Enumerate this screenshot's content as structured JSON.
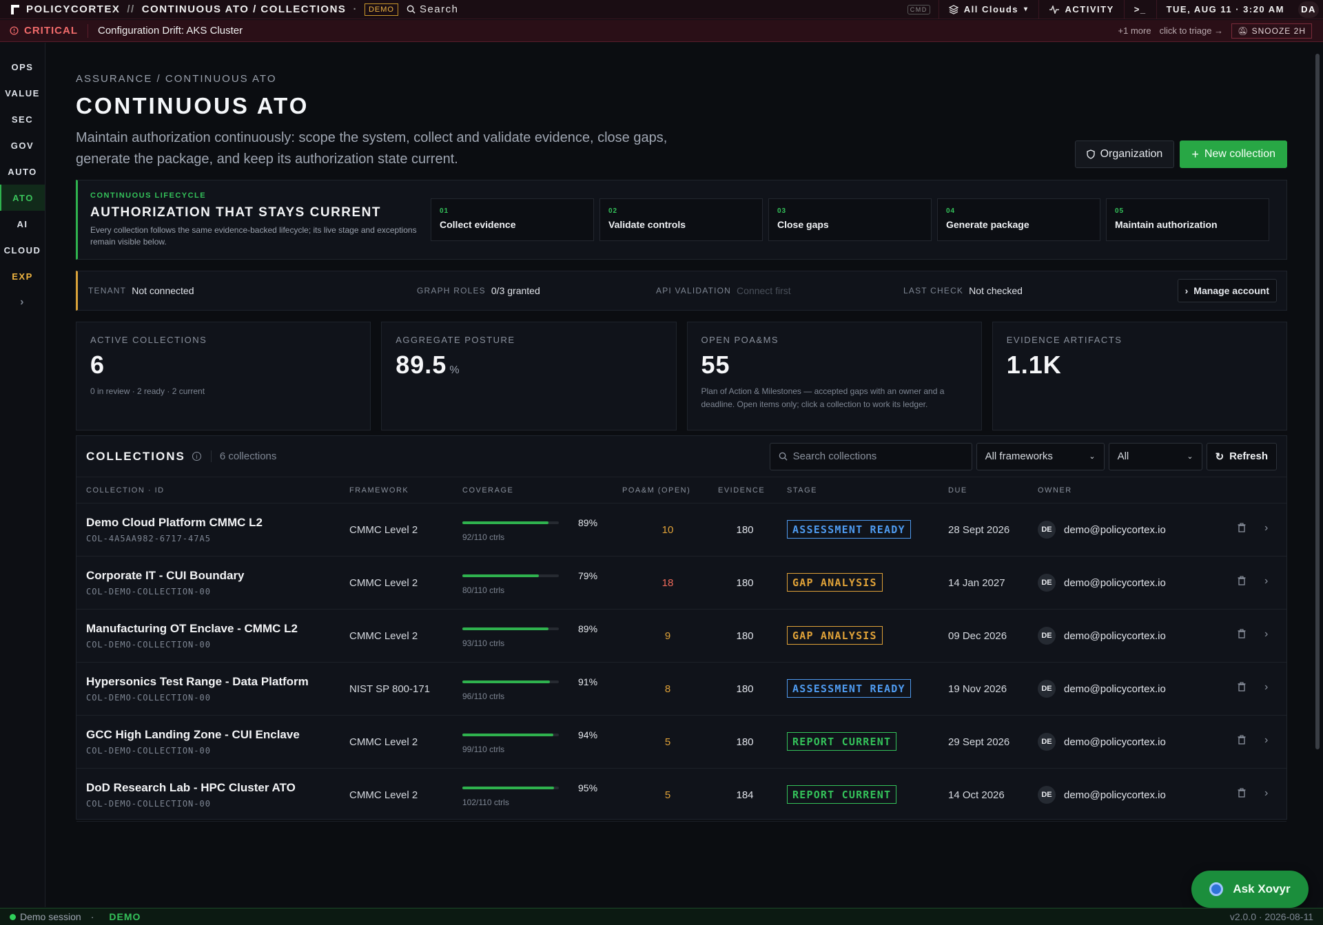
{
  "topbar": {
    "brand": "POLICYCORTEX",
    "sep": "//",
    "path": "CONTINUOUS ATO / COLLECTIONS",
    "dot": "·",
    "demo_badge": "DEMO",
    "search_label": "Search",
    "kbd": "CMD",
    "clouds": "All Clouds",
    "activity": "ACTIVITY",
    "terminal": ">_",
    "datetime": "TUE, AUG 11 · 3:20 AM",
    "avatar": "DA"
  },
  "alert": {
    "level": "CRITICAL",
    "message": "Configuration Drift: AKS Cluster",
    "more": "+1 more",
    "triage": "click to triage →",
    "snooze": "SNOOZE 2H"
  },
  "sidebar": {
    "items": [
      {
        "label": "OPS"
      },
      {
        "label": "VALUE"
      },
      {
        "label": "SEC"
      },
      {
        "label": "GOV"
      },
      {
        "label": "AUTO"
      },
      {
        "label": "ATO"
      },
      {
        "label": "AI"
      },
      {
        "label": "CLOUD"
      },
      {
        "label": "EXP"
      }
    ],
    "expand": "›"
  },
  "header": {
    "breadcrumb": "ASSURANCE / CONTINUOUS ATO",
    "title": "CONTINUOUS ATO",
    "description": "Maintain authorization continuously: scope the system, collect and validate evidence, close gaps, generate the package, and keep its authorization state current.",
    "org_button": "Organization",
    "new_button": "New collection"
  },
  "lifecycle": {
    "eyebrow": "CONTINUOUS LIFECYCLE",
    "title": "AUTHORIZATION THAT STAYS CURRENT",
    "subtitle": "Every collection follows the same evidence-backed lifecycle; its live stage and exceptions remain visible below.",
    "steps": [
      {
        "num": "01",
        "label": "Collect evidence"
      },
      {
        "num": "02",
        "label": "Validate controls"
      },
      {
        "num": "03",
        "label": "Close gaps"
      },
      {
        "num": "04",
        "label": "Generate package"
      },
      {
        "num": "05",
        "label": "Maintain authorization"
      }
    ]
  },
  "tenant": {
    "tenant_key": "TENANT",
    "tenant_val": "Not connected",
    "roles_key": "GRAPH ROLES",
    "roles_val": "0/3 granted",
    "api_key": "API VALIDATION",
    "api_val": "Connect first",
    "check_key": "LAST CHECK",
    "check_val": "Not checked",
    "manage": "Manage account"
  },
  "kpis": {
    "active": {
      "label": "ACTIVE COLLECTIONS",
      "value": "6",
      "sub": "0 in review · 2 ready · 2 current"
    },
    "posture": {
      "label": "AGGREGATE POSTURE",
      "value": "89.5",
      "unit": "%"
    },
    "poams": {
      "label": "OPEN POA&MS",
      "value": "55",
      "sub": "Plan of Action & Milestones — accepted gaps with an owner and a deadline. Open items only; click a collection to work its ledger."
    },
    "evidence": {
      "label": "EVIDENCE ARTIFACTS",
      "value": "1.1K"
    }
  },
  "collections": {
    "title": "COLLECTIONS",
    "count": "6 collections",
    "search_placeholder": "Search collections",
    "framework_filter": "All frameworks",
    "stage_filter": "All",
    "refresh": "Refresh",
    "columns": {
      "name": "COLLECTION · ID",
      "framework": "FRAMEWORK",
      "coverage": "COVERAGE",
      "poam": "POA&M (OPEN)",
      "evidence": "EVIDENCE",
      "stage": "STAGE",
      "due": "DUE",
      "owner": "OWNER"
    },
    "rows": [
      {
        "name": "Demo Cloud Platform CMMC L2",
        "id": "COL-4A5AA982-6717-47A5",
        "framework": "CMMC Level 2",
        "coverage": 0.89,
        "pct": "89%",
        "ctrls": "92/110 ctrls",
        "poam": "10",
        "evidence": "180",
        "stage": "ASSESSMENT READY",
        "stage_color": "#4f9bf0",
        "due": "28 Sept 2026",
        "owner_initials": "DE",
        "owner": "demo@policycortex.io"
      },
      {
        "name": "Corporate IT - CUI Boundary",
        "id": "COL-DEMO-COLLECTION-00",
        "framework": "CMMC Level 2",
        "coverage": 0.79,
        "pct": "79%",
        "ctrls": "80/110 ctrls",
        "poam": "18",
        "evidence": "180",
        "stage": "GAP ANALYSIS",
        "stage_color": "#e0a238",
        "due": "14 Jan 2027",
        "owner_initials": "DE",
        "owner": "demo@policycortex.io"
      },
      {
        "name": "Manufacturing OT Enclave - CMMC L2",
        "id": "COL-DEMO-COLLECTION-00",
        "framework": "CMMC Level 2",
        "coverage": 0.89,
        "pct": "89%",
        "ctrls": "93/110 ctrls",
        "poam": "9",
        "evidence": "180",
        "stage": "GAP ANALYSIS",
        "stage_color": "#e0a238",
        "due": "09 Dec 2026",
        "owner_initials": "DE",
        "owner": "demo@policycortex.io"
      },
      {
        "name": "Hypersonics Test Range - Data Platform",
        "id": "COL-DEMO-COLLECTION-00",
        "framework": "NIST SP 800-171",
        "coverage": 0.91,
        "pct": "91%",
        "ctrls": "96/110 ctrls",
        "poam": "8",
        "evidence": "180",
        "stage": "ASSESSMENT READY",
        "stage_color": "#4f9bf0",
        "due": "19 Nov 2026",
        "owner_initials": "DE",
        "owner": "demo@policycortex.io"
      },
      {
        "name": "GCC High Landing Zone - CUI Enclave",
        "id": "COL-DEMO-COLLECTION-00",
        "framework": "CMMC Level 2",
        "coverage": 0.94,
        "pct": "94%",
        "ctrls": "99/110 ctrls",
        "poam": "5",
        "evidence": "180",
        "stage": "REPORT CURRENT",
        "stage_color": "#34c25a",
        "due": "29 Sept 2026",
        "owner_initials": "DE",
        "owner": "demo@policycortex.io"
      },
      {
        "name": "DoD Research Lab - HPC Cluster ATO",
        "id": "COL-DEMO-COLLECTION-00",
        "framework": "CMMC Level 2",
        "coverage": 0.95,
        "pct": "95%",
        "ctrls": "102/110 ctrls",
        "poam": "5",
        "evidence": "184",
        "stage": "REPORT CURRENT",
        "stage_color": "#34c25a",
        "due": "14 Oct 2026",
        "owner_initials": "DE",
        "owner": "demo@policycortex.io"
      }
    ]
  },
  "ask": {
    "label": "Ask Xovyr"
  },
  "footer": {
    "session": "Demo session",
    "sep": "·",
    "mode": "DEMO",
    "version": "v2.0.0 · 2026-08-11"
  },
  "colors": {
    "accent": "#28a745",
    "critical": "#f16b6b",
    "warning": "#e0a238",
    "info": "#4f9bf0"
  }
}
